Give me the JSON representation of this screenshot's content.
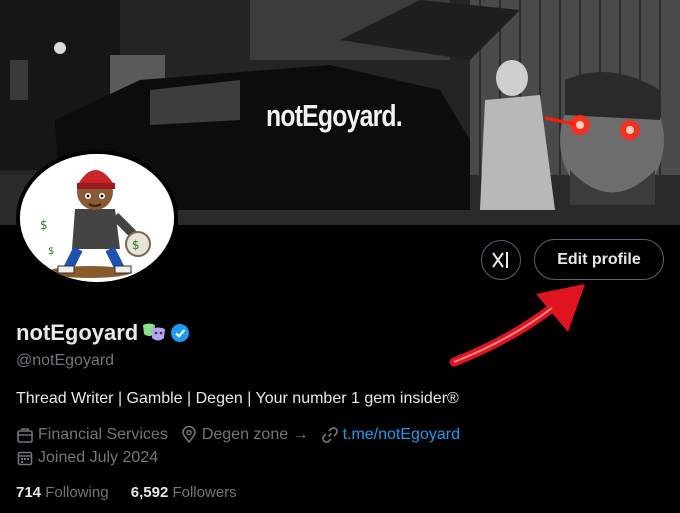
{
  "banner": {
    "text": "notEgoyard."
  },
  "profile": {
    "display_name": "notEgoyard",
    "handle": "@notEgoyard",
    "bio": "Thread Writer | Gamble | Degen |  Your number 1 gem insider®",
    "category": "Financial Services",
    "location": "Degen zone →",
    "link": "t.me/notEgoyard",
    "joined": "Joined July 2024"
  },
  "actions": {
    "edit_label": "Edit profile",
    "xai_icon": "grok-icon"
  },
  "stats": {
    "following_count": "714",
    "following_label": "Following",
    "followers_count": "6,592",
    "followers_label": "Followers"
  },
  "colors": {
    "accent": "#1d9bf0",
    "muted": "#71767b",
    "text": "#e7e9ea",
    "arrow": "#e0141e"
  }
}
